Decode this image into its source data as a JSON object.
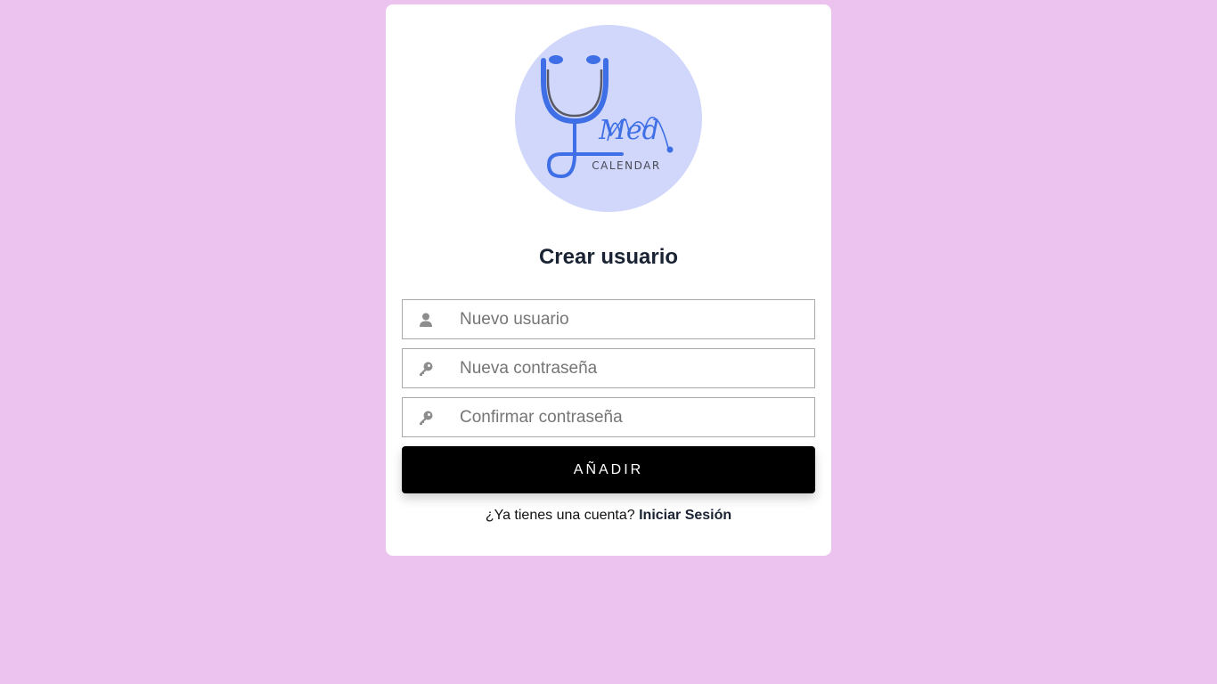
{
  "logo": {
    "script_text": "Med",
    "caption": "CALENDAR",
    "icon": "stethoscope-icon",
    "circle_color": "#d0d7fb",
    "accent_color": "#3f6fe6"
  },
  "form": {
    "title": "Crear usuario",
    "username": {
      "placeholder": "Nuevo usuario",
      "value": "",
      "icon": "user-icon"
    },
    "password": {
      "placeholder": "Nueva contraseña",
      "value": "",
      "icon": "key-icon"
    },
    "confirm": {
      "placeholder": "Confirmar contraseña",
      "value": "",
      "icon": "key-icon"
    },
    "submit_label": "AÑADIR"
  },
  "footer": {
    "prompt": "¿Ya tienes una cuenta?",
    "link_label": "Iniciar Sesión"
  },
  "colors": {
    "background": "#ecc3ef",
    "card": "#ffffff",
    "button": "#000000"
  }
}
